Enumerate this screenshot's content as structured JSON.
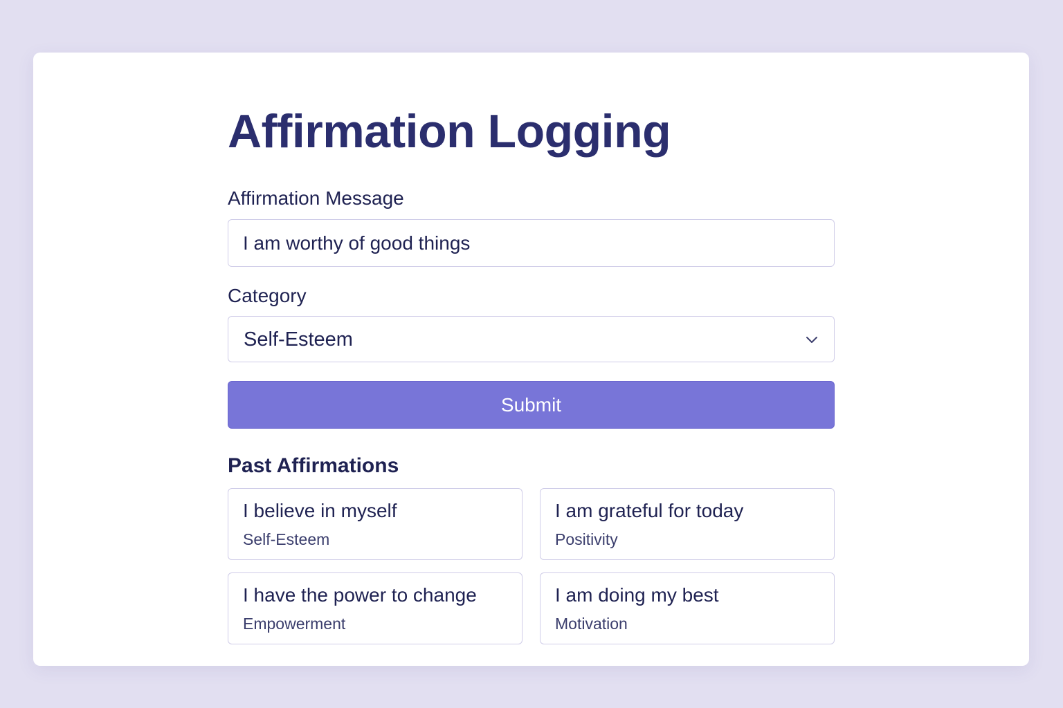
{
  "page": {
    "title": "Affirmation Logging"
  },
  "form": {
    "message_label": "Affirmation Message",
    "message_value": "I am worthy of good things",
    "category_label": "Category",
    "category_value": "Self-Esteem",
    "submit_label": "Submit"
  },
  "past": {
    "heading": "Past Affirmations",
    "items": [
      {
        "message": "I believe in myself",
        "category": "Self-Esteem"
      },
      {
        "message": "I am grateful for today",
        "category": "Positivity"
      },
      {
        "message": "I have the power to change",
        "category": "Empowerment"
      },
      {
        "message": "I am doing my best",
        "category": "Motivation"
      }
    ]
  },
  "icons": {
    "select_chevron": "chevron-down-icon"
  },
  "colors": {
    "background": "#e2dff1",
    "title": "#2b2e6e",
    "accent": "#7875d8",
    "border": "#cfcce8"
  }
}
